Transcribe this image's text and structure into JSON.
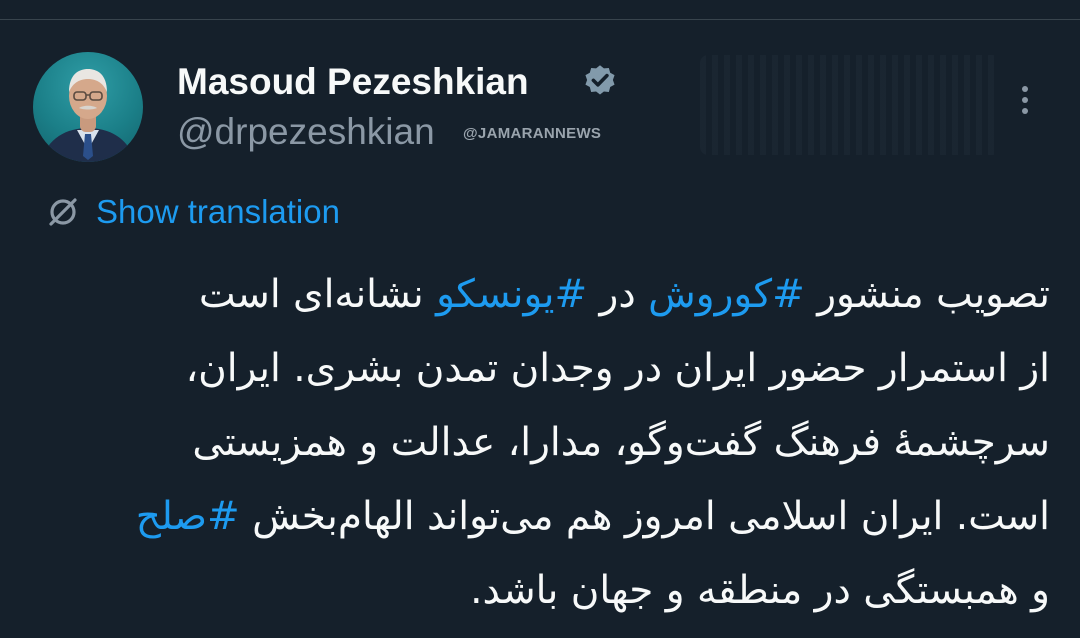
{
  "author": {
    "display_name": "Masoud Pezeshkian",
    "handle": "@drpezeshkian",
    "verified": true
  },
  "watermark": "@JAMARANNEWS",
  "translate": {
    "label": "Show translation",
    "icon": "globe-strike-icon"
  },
  "menu": {
    "icon": "more-vertical-icon"
  },
  "tweet": {
    "lines": [
      {
        "segments": [
          {
            "text": "تصویب منشور ",
            "hashtag": false
          },
          {
            "text": "#کوروش",
            "hashtag": true
          },
          {
            "text": " در ",
            "hashtag": false
          },
          {
            "text": "#یونسکو",
            "hashtag": true
          },
          {
            "text": " نشانه‌ای است",
            "hashtag": false
          }
        ]
      },
      {
        "segments": [
          {
            "text": "از استمرار حضور ایران در وجدان تمدن بشری. ایران،",
            "hashtag": false
          }
        ]
      },
      {
        "segments": [
          {
            "text": "سرچشمهٔ فرهنگ گفت‌وگو، مدارا، عدالت و همزیستی",
            "hashtag": false
          }
        ]
      },
      {
        "segments": [
          {
            "text": "است. ایران اسلامی امروز هم می‌تواند الهام‌بخش ",
            "hashtag": false
          },
          {
            "text": "#صلح",
            "hashtag": true
          }
        ]
      },
      {
        "segments": [
          {
            "text": "و همبستگی در منطقه و جهان باشد.",
            "hashtag": false
          }
        ]
      }
    ]
  },
  "colors": {
    "background": "#15202b",
    "text": "#f7f9f9",
    "secondary_text": "#8b98a5",
    "link": "#1d9bf0",
    "divider": "#38444d"
  }
}
